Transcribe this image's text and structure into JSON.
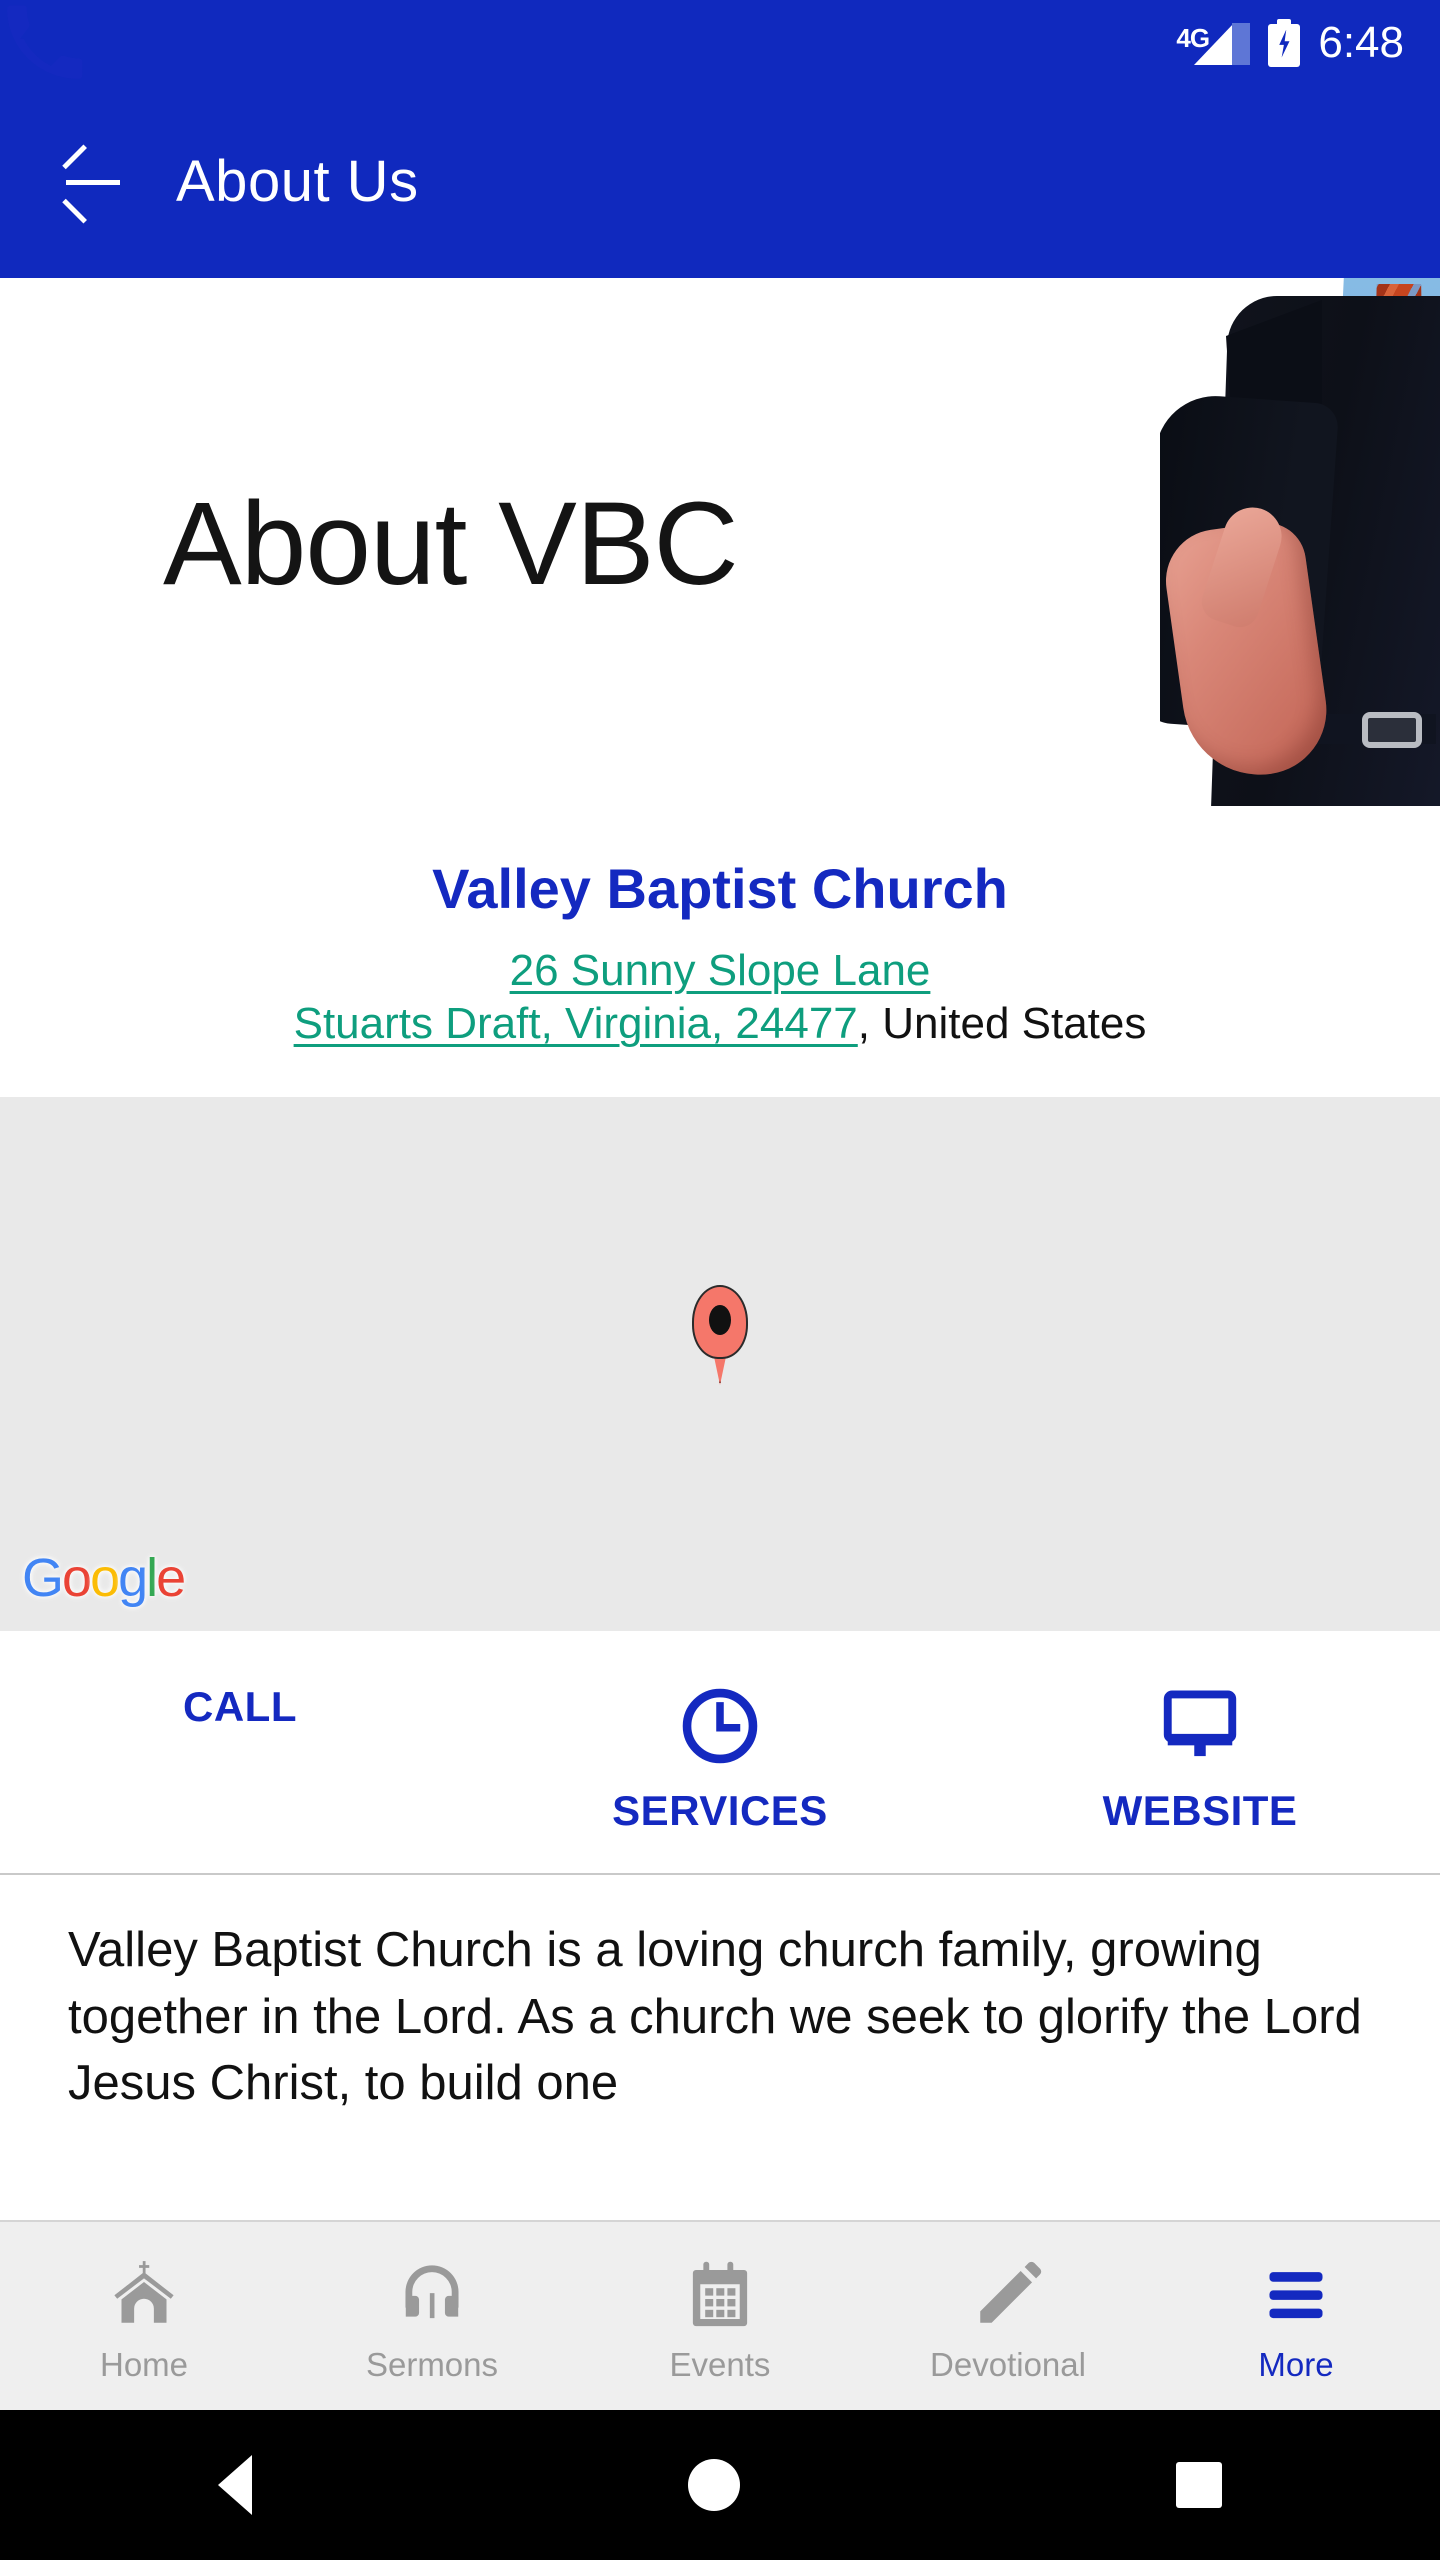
{
  "status_bar": {
    "network": "4G",
    "time": "6:48",
    "battery_state": "charging"
  },
  "app_bar": {
    "title": "About Us",
    "back_icon": "arrow-left-icon"
  },
  "hero": {
    "heading": "About VBC",
    "image_description": "businessman-handshake"
  },
  "info": {
    "church_name": "Valley Baptist Church",
    "address_line_1": "26 Sunny Slope Lane",
    "address_line_2": "Stuarts Draft, Virginia, 24477",
    "country": ", United States"
  },
  "map": {
    "marker": "location-pin",
    "attribution_letters": [
      "G",
      "o",
      "o",
      "g",
      "l",
      "e"
    ]
  },
  "actions": [
    {
      "label": "CALL",
      "icon": "phone-icon"
    },
    {
      "label": "SERVICES",
      "icon": "clock-icon"
    },
    {
      "label": "WEBSITE",
      "icon": "monitor-icon"
    }
  ],
  "description": {
    "text": "Valley Baptist Church is a loving church family, growing together in the Lord. As a church we seek to glorify the Lord Jesus Christ, to build one"
  },
  "bottom_nav": [
    {
      "label": "Home",
      "icon": "church-icon",
      "active": false
    },
    {
      "label": "Sermons",
      "icon": "headphones-icon",
      "active": false
    },
    {
      "label": "Events",
      "icon": "calendar-icon",
      "active": false
    },
    {
      "label": "Devotional",
      "icon": "pencil-icon",
      "active": false
    },
    {
      "label": "More",
      "icon": "hamburger-menu-icon",
      "active": true
    }
  ],
  "system_nav": {
    "back": "back-triangle-icon",
    "home": "home-circle-icon",
    "recents": "recents-square-icon"
  },
  "colors": {
    "brand_blue": "#1029BE",
    "accent_blue": "#1429C0",
    "link_teal": "#0E9E7E",
    "map_gray": "#E9E9E9",
    "nav_gray": "#9A9A9A"
  }
}
